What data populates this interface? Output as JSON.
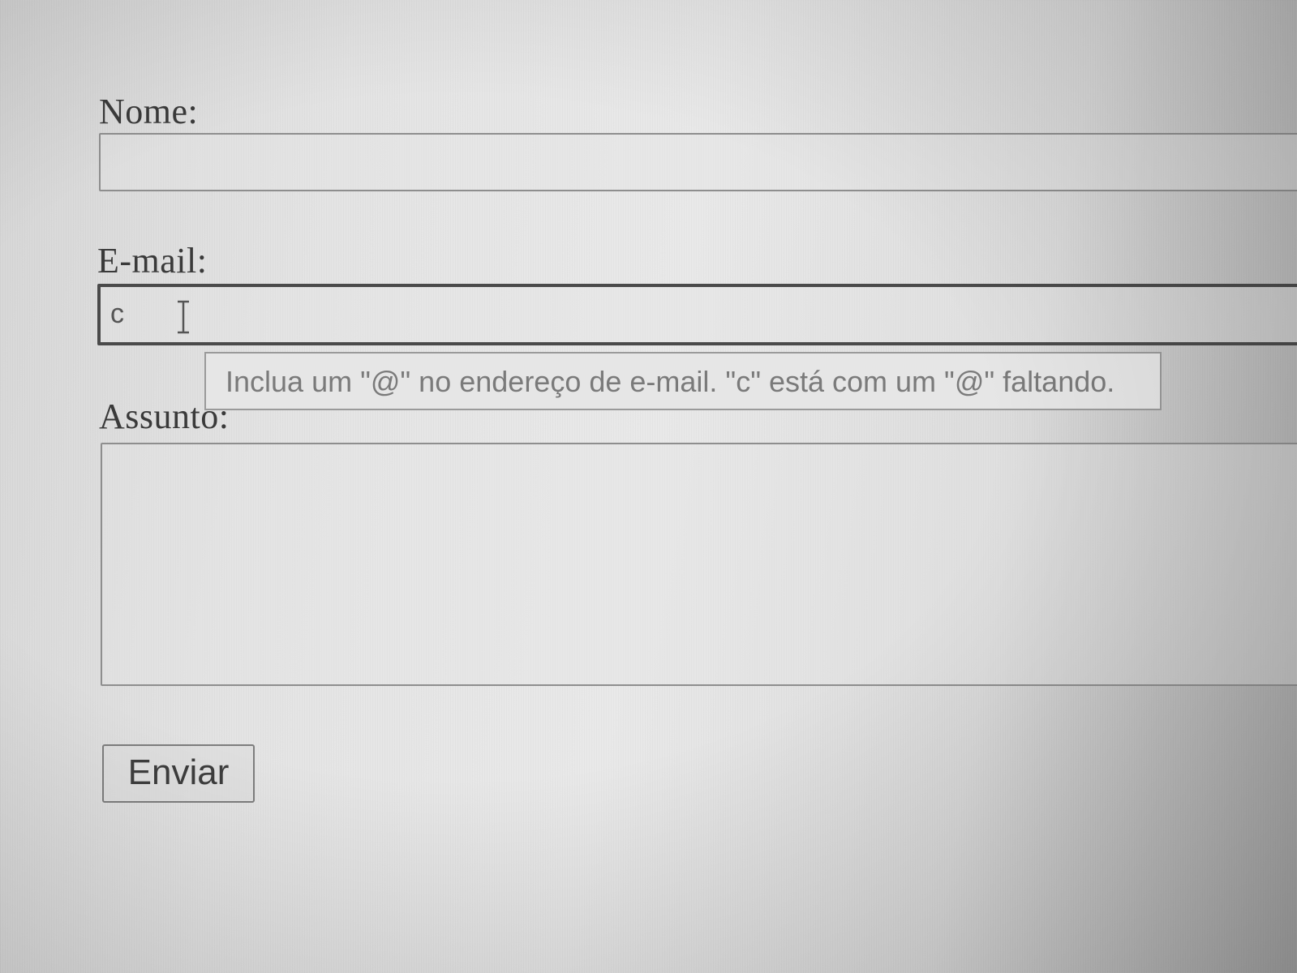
{
  "form": {
    "name_label": "Nome:",
    "name_value": "",
    "email_label": "E-mail:",
    "email_value": "c",
    "subject_label": "Assunto:",
    "subject_value": "",
    "submit_label": "Enviar"
  },
  "validation": {
    "message": "Inclua um \"@\" no endereço de e-mail. \"c\" está com um \"@\" faltando."
  },
  "icons": {
    "cursor": "text-cursor-icon"
  }
}
